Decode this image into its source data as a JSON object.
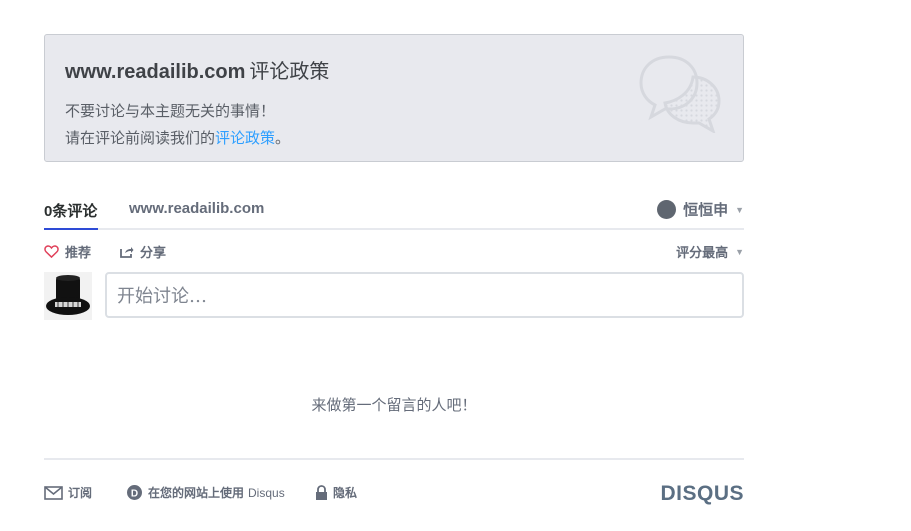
{
  "policy": {
    "site": "www.readailib.com",
    "title_suffix": "评论政策",
    "line1": "不要讨论与本主题无关的事情！",
    "line2_prefix": "请在评论前阅读我们的",
    "line2_link": "评论政策",
    "line2_suffix": "。"
  },
  "nav": {
    "comments_tab": "0条评论",
    "site_tab": "www.readailib.com",
    "user_name": "恒恒申"
  },
  "toolbar": {
    "recommend": "推荐",
    "share": "分享",
    "sort": "评分最高"
  },
  "composer": {
    "placeholder": "开始讨论…"
  },
  "empty_message": "来做第一个留言的人吧！",
  "footer": {
    "subscribe": "订阅",
    "use_on_site": "在您的网站上使用",
    "use_on_site_brand": "Disqus",
    "privacy": "隐私",
    "logo": "DISQUS"
  },
  "colors": {
    "accent": "#2e9fff",
    "tab_underline": "#2e4bd6",
    "recommend_heart": "#e0405a",
    "logo": "#5b6f83"
  },
  "icons": {
    "policy_bg": "speech-bubbles-icon",
    "recommend": "heart-icon",
    "share": "share-icon",
    "subscribe": "envelope-icon",
    "disqus_badge": "disqus-d-icon",
    "privacy": "lock-icon"
  }
}
